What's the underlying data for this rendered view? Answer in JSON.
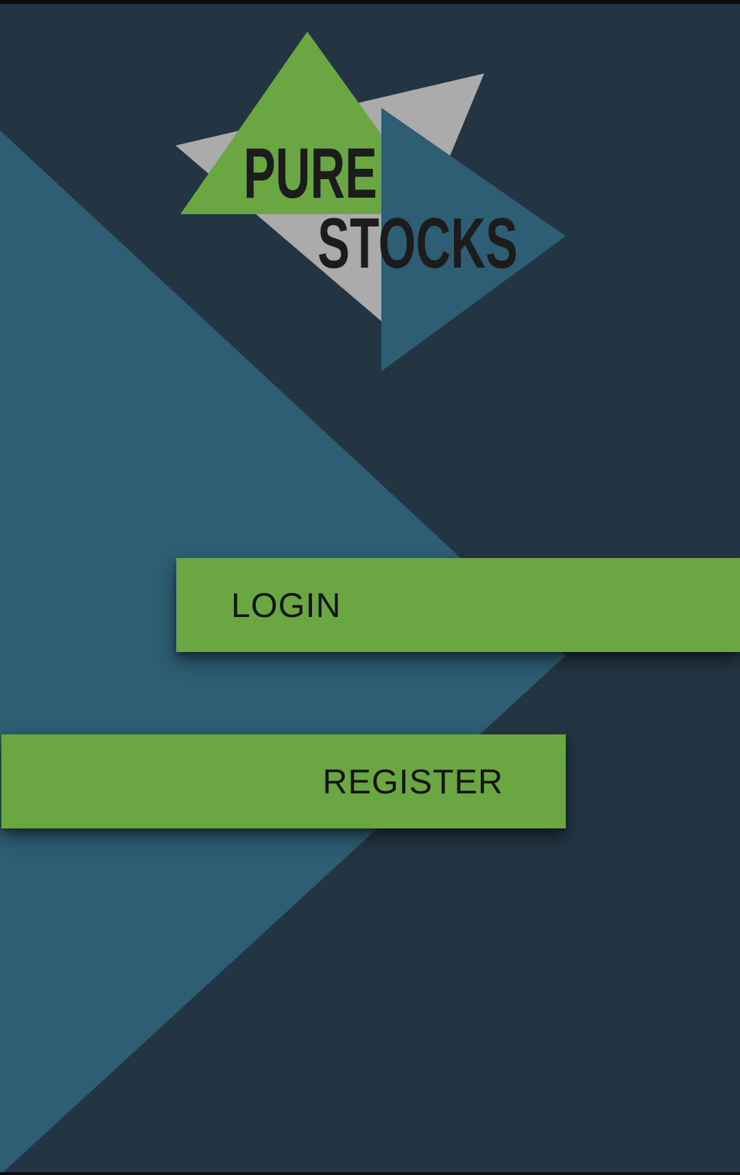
{
  "app": {
    "logo": {
      "line1": "PURE",
      "line2": "STOCKS"
    }
  },
  "actions": {
    "login_label": "LOGIN",
    "register_label": "REGISTER"
  },
  "colors": {
    "background_dark": "#233543",
    "background_teal": "#2e5e74",
    "accent_green": "#6aa641",
    "logo_gray": "#ababab",
    "text_dark": "#141414"
  }
}
